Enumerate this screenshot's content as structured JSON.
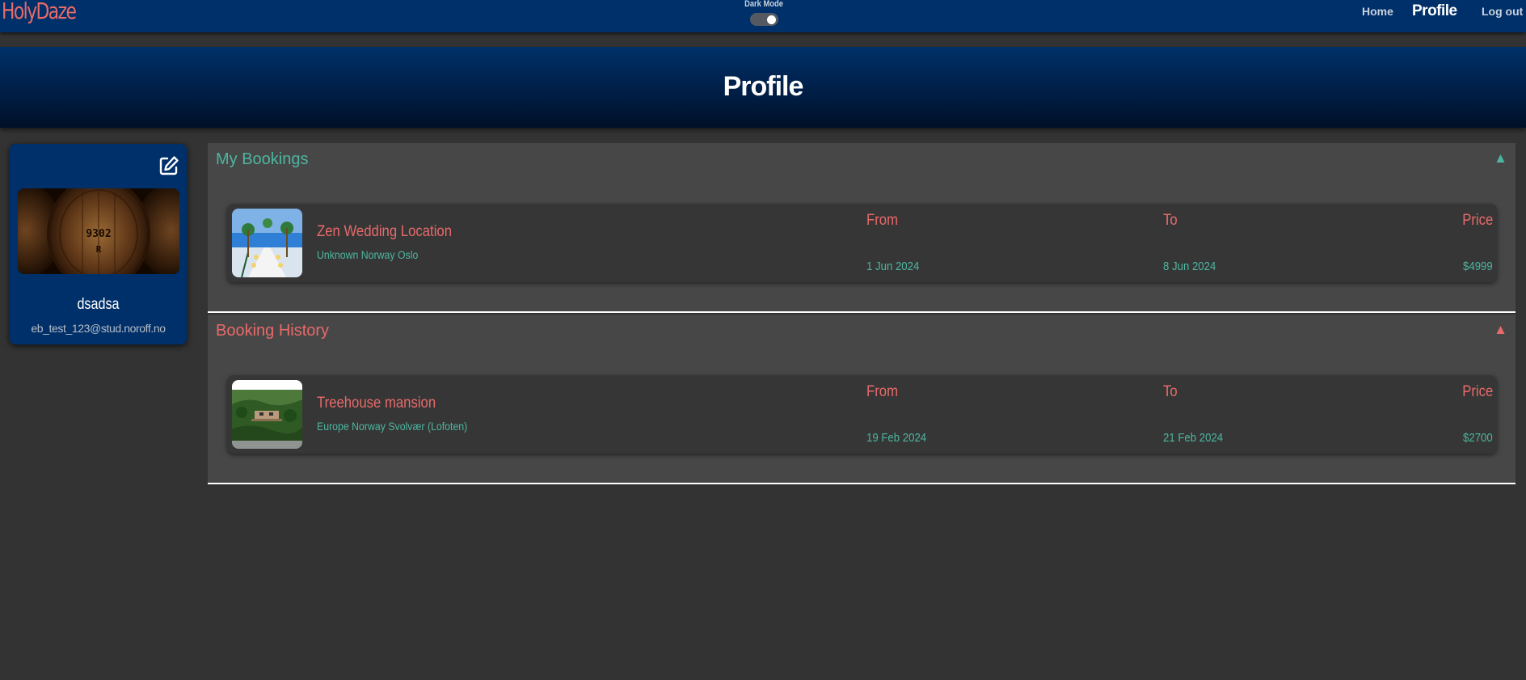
{
  "nav": {
    "brand": "HolyDaze",
    "dark_mode_label": "Dark Mode",
    "dark_mode_on": true,
    "links": {
      "home": "Home",
      "profile": "Profile",
      "logout": "Log out"
    }
  },
  "hero": {
    "title": "Profile"
  },
  "profile": {
    "name": "dsadsa",
    "email": "eb_test_123@stud.noroff.no",
    "avatar_icon": "wine-barrel-photo",
    "edit_icon": "edit-icon"
  },
  "sections": {
    "bookings": {
      "title": "My Bookings",
      "toggle": "▲",
      "items": [
        {
          "name": "Zen Wedding Location",
          "location": "Unknown Norway Oslo",
          "from_label": "From",
          "to_label": "To",
          "price_label": "Price",
          "from": "1 Jun 2024",
          "to": "8 Jun 2024",
          "price": "$4999",
          "thumb": "beach-wedding-photo"
        }
      ]
    },
    "history": {
      "title": "Booking History",
      "toggle": "▲",
      "items": [
        {
          "name": "Treehouse mansion",
          "location": "Europe Norway Svolvær (Lofoten)",
          "from_label": "From",
          "to_label": "To",
          "price_label": "Price",
          "from": "19 Feb 2024",
          "to": "21 Feb 2024",
          "price": "$2700",
          "thumb": "forest-house-photo"
        }
      ]
    }
  },
  "colors": {
    "nav_bg": "#003069",
    "brand": "#e86a6a",
    "teal": "#4db6a0",
    "coral": "#e86a6a",
    "page_bg": "#333333",
    "section_bg": "#474747",
    "row_bg": "#363636"
  }
}
